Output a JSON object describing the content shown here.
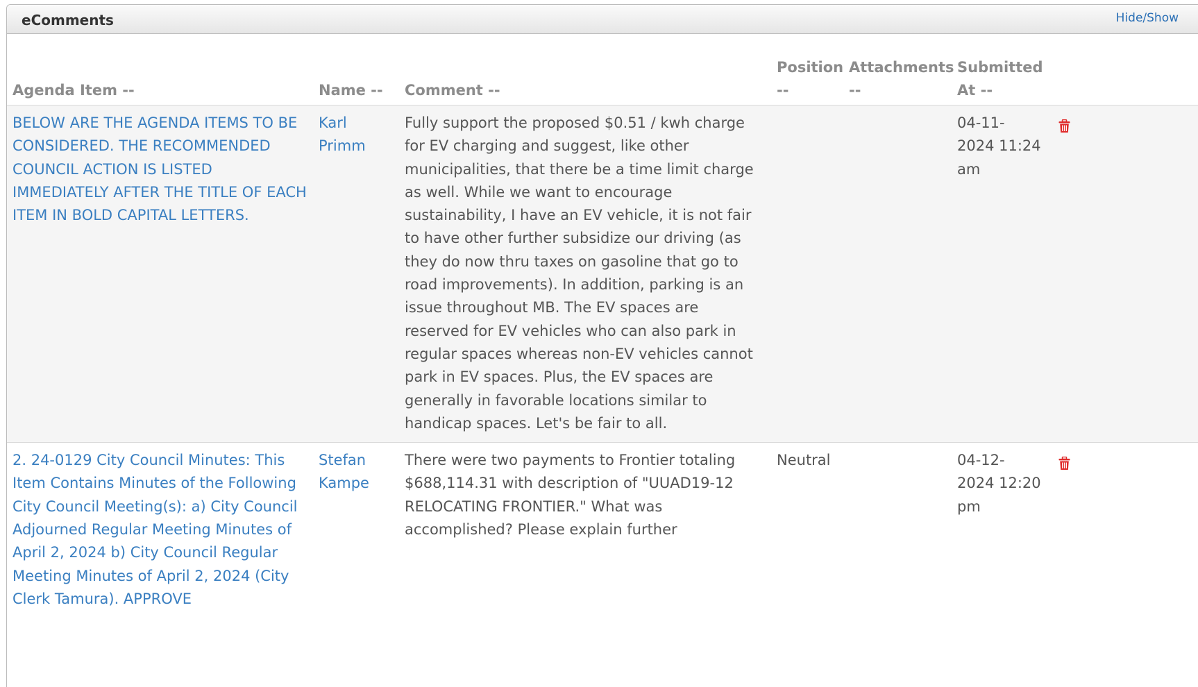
{
  "panel": {
    "title": "eComments",
    "hide_show_label": "Hide/Show"
  },
  "columns": {
    "agenda_item": "Agenda Item --",
    "name": "Name --",
    "comment": "Comment --",
    "position": "Position --",
    "attachments": "Attachments --",
    "submitted_at": "Submitted At --"
  },
  "rows": [
    {
      "agenda_item": "BELOW ARE THE AGENDA ITEMS TO BE CONSIDERED. THE RECOMMENDED COUNCIL ACTION IS LISTED IMMEDIATELY AFTER THE TITLE OF EACH ITEM IN BOLD CAPITAL LETTERS.",
      "name": "Karl Primm",
      "comment": "Fully support the proposed $0.51 / kwh charge for EV charging and suggest, like other municipalities, that there be a time limit charge as well. While we want to encourage sustainability, I have an EV vehicle, it is not fair to have other further subsidize our driving (as they do now thru taxes on gasoline that go to road improvements). In addition, parking is an issue throughout MB. The EV spaces are reserved for EV vehicles who can also park in regular spaces whereas non-EV vehicles cannot park in EV spaces. Plus, the EV spaces are generally in favorable locations similar to handicap spaces. Let's be fair to all.",
      "position": "",
      "attachments": "",
      "submitted_at": "04-11-2024 11:24 am",
      "delete_icon": "trash-icon"
    },
    {
      "agenda_item": "2. 24-0129 City Council Minutes: This Item Contains Minutes of the Following City Council Meeting(s): a) City Council Adjourned Regular Meeting Minutes of April 2, 2024 b) City Council Regular Meeting Minutes of April 2, 2024 (City Clerk Tamura). APPROVE",
      "name": "Stefan Kampe",
      "comment": "There were two payments to Frontier totaling $688,114.31 with description of \"UUAD19-12 RELOCATING FRONTIER.\" What was accomplished? Please explain further",
      "position": "Neutral",
      "attachments": "",
      "submitted_at": "04-12-2024 12:20 pm",
      "delete_icon": "trash-icon"
    }
  ],
  "colors": {
    "link": "#3a7fc1",
    "header_text": "#8c8c8c",
    "body_text": "#555555",
    "trash": "#e02b2b"
  }
}
